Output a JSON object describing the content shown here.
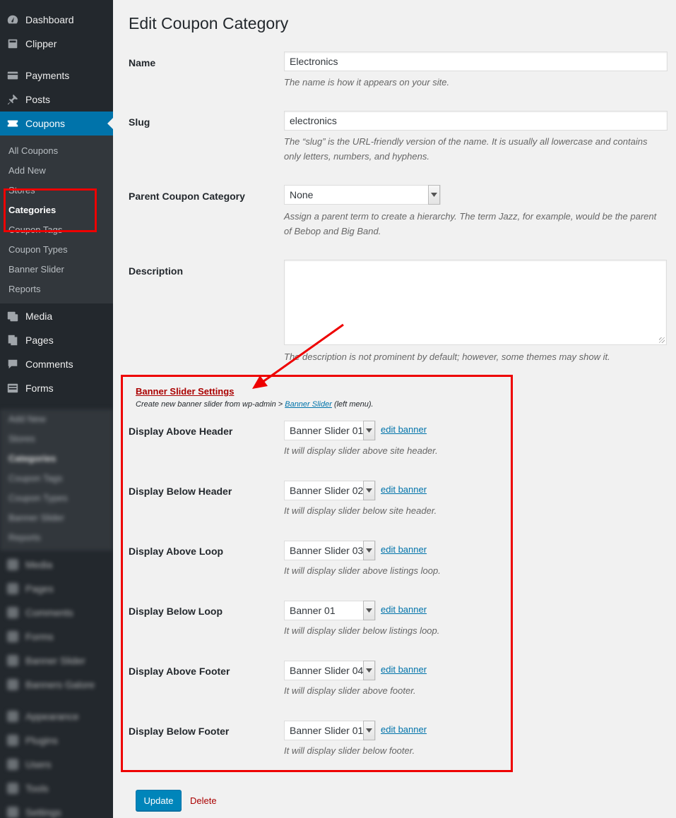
{
  "sidebar": {
    "top_items": [
      {
        "label": "Dashboard",
        "icon": "dashboard-icon"
      },
      {
        "label": "Clipper",
        "icon": "clipper-icon"
      },
      {
        "label": "Payments",
        "icon": "payments-icon"
      },
      {
        "label": "Posts",
        "icon": "pin-icon"
      },
      {
        "label": "Coupons",
        "icon": "coupons-icon"
      }
    ],
    "submenu": [
      "All Coupons",
      "Add New",
      "Stores",
      "Categories",
      "Coupon Tags",
      "Coupon Types",
      "Banner Slider",
      "Reports"
    ],
    "bottom_items": [
      {
        "label": "Media",
        "icon": "media-icon"
      },
      {
        "label": "Pages",
        "icon": "pages-icon"
      },
      {
        "label": "Comments",
        "icon": "comments-icon"
      },
      {
        "label": "Forms",
        "icon": "forms-icon"
      }
    ],
    "blurred_submenu": [
      "Add New",
      "Stores",
      "Categories",
      "Coupon Tags",
      "Coupon Types",
      "Banner Slider",
      "Reports"
    ],
    "blurred_items": [
      "Media",
      "Pages",
      "Comments",
      "Forms",
      "Banner Slider",
      "Banners Galore",
      "Appearance",
      "Plugins",
      "Users",
      "Tools",
      "Settings"
    ]
  },
  "page": {
    "title": "Edit Coupon Category",
    "name_label": "Name",
    "name_value": "Electronics",
    "name_desc": "The name is how it appears on your site.",
    "slug_label": "Slug",
    "slug_value": "electronics",
    "slug_desc_1": "The “slug” is the URL-friendly version of the name. It is usually all lowercase and contains",
    "slug_desc_2": "only letters, numbers, and hyphens.",
    "parent_label": "Parent Coupon Category",
    "parent_value": "None",
    "parent_desc_1": "Assign a parent term to create a hierarchy. The term Jazz, for example, would be the parent",
    "parent_desc_2": "of Bebop and Big Band.",
    "description_label": "Description",
    "description_desc": "The description is not prominent by default; however, some themes may show it."
  },
  "banner_settings": {
    "title": "Banner Slider Settings",
    "note_prefix": "Create new banner slider from wp-admin > ",
    "note_link": "Banner Slider",
    "note_suffix": " (left menu).",
    "edit_label": "edit banner",
    "rows": [
      {
        "label": "Display Above Header",
        "value": "Banner Slider 01",
        "desc": "It will display slider above site header."
      },
      {
        "label": "Display Below Header",
        "value": "Banner Slider 02",
        "desc": "It will display slider below site header."
      },
      {
        "label": "Display Above Loop",
        "value": "Banner Slider 03",
        "desc": "It will display slider above listings loop."
      },
      {
        "label": "Display Below Loop",
        "value": "Banner 01",
        "desc": "It will display slider below listings loop."
      },
      {
        "label": "Display Above Footer",
        "value": "Banner Slider 04",
        "desc": "It will display slider above footer."
      },
      {
        "label": "Display Below Footer",
        "value": "Banner Slider 01",
        "desc": "It will display slider below footer."
      }
    ]
  },
  "actions": {
    "update": "Update",
    "delete": "Delete"
  },
  "colors": {
    "sidebar": "#23282d",
    "submenu": "#32373c",
    "active": "#0073aa",
    "annotation": "#ee0000"
  }
}
